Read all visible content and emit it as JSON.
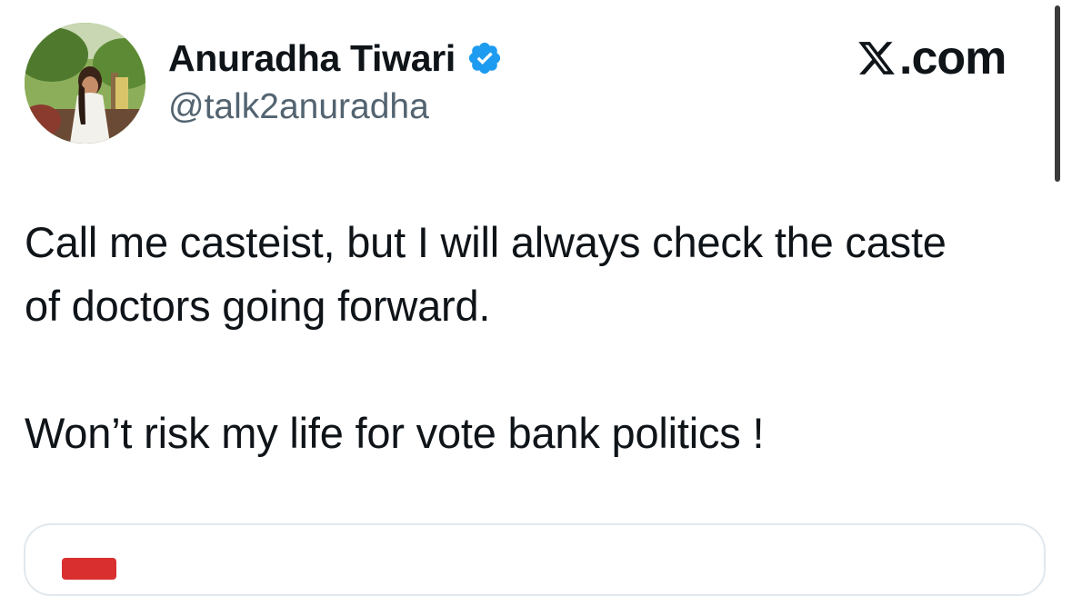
{
  "author": {
    "display_name": "Anuradha Tiwari",
    "handle": "@talk2anuradha",
    "verified": true,
    "avatar": "profile-photo"
  },
  "brand": {
    "text": ".com",
    "logo": "x-logo-icon"
  },
  "tweet": {
    "paragraphs": [
      "Call me casteist, but I will always check the caste\nof doctors going forward.",
      "Won’t risk my life for vote bank politics !"
    ]
  },
  "colors": {
    "verified_badge": "#1d9bf0",
    "text_primary": "#0f1419",
    "text_secondary": "#536471",
    "card_icon": "#d9302f"
  }
}
